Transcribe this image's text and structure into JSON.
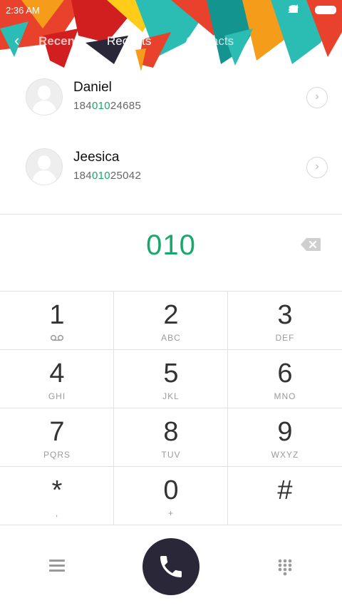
{
  "status_bar": {
    "time": "2:36 AM"
  },
  "nav": {
    "back_title": "Recents",
    "tabs": [
      {
        "label": "Recents",
        "active": true
      },
      {
        "label": "Contacts",
        "active": false
      }
    ]
  },
  "results": [
    {
      "name": "Daniel",
      "number_prefix": "184",
      "number_match": "010",
      "number_suffix": "24685"
    },
    {
      "name": "Jeesica",
      "number_prefix": "184",
      "number_match": "010",
      "number_suffix": "25042"
    }
  ],
  "dial_input": "010",
  "keypad": [
    {
      "digit": "1",
      "letters": ""
    },
    {
      "digit": "2",
      "letters": "ABC"
    },
    {
      "digit": "3",
      "letters": "DEF"
    },
    {
      "digit": "4",
      "letters": "GHI"
    },
    {
      "digit": "5",
      "letters": "JKL"
    },
    {
      "digit": "6",
      "letters": "MNO"
    },
    {
      "digit": "7",
      "letters": "PQRS"
    },
    {
      "digit": "8",
      "letters": "TUV"
    },
    {
      "digit": "9",
      "letters": "WXYZ"
    },
    {
      "digit": "*",
      "letters": ","
    },
    {
      "digit": "0",
      "letters": "+"
    },
    {
      "digit": "#",
      "letters": ""
    }
  ],
  "colors": {
    "accent": "#1aa76b",
    "call_button": "#2a2838"
  },
  "icons": {
    "back": "chevron-left-icon",
    "backspace": "backspace-icon",
    "voicemail": "voicemail-icon",
    "menu": "menu-icon",
    "call": "phone-icon",
    "dialpad": "dialpad-icon"
  }
}
